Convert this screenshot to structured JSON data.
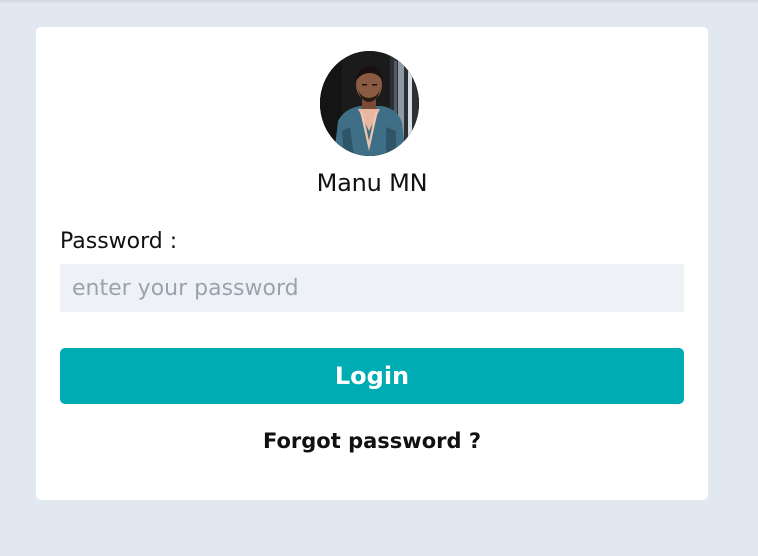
{
  "profile": {
    "name": "Manu MN"
  },
  "form": {
    "password_label": "Password :",
    "password_placeholder": "enter your password",
    "password_value": ""
  },
  "actions": {
    "login_label": "Login",
    "forgot_label": "Forgot password ?"
  },
  "colors": {
    "page_bg": "#e2e8f0",
    "card_bg": "#ffffff",
    "input_bg": "#eef2f7",
    "accent": "#00acb4",
    "text": "#111111",
    "placeholder": "#9aa3ad"
  },
  "icons": {
    "avatar": "user-photo-avatar"
  }
}
